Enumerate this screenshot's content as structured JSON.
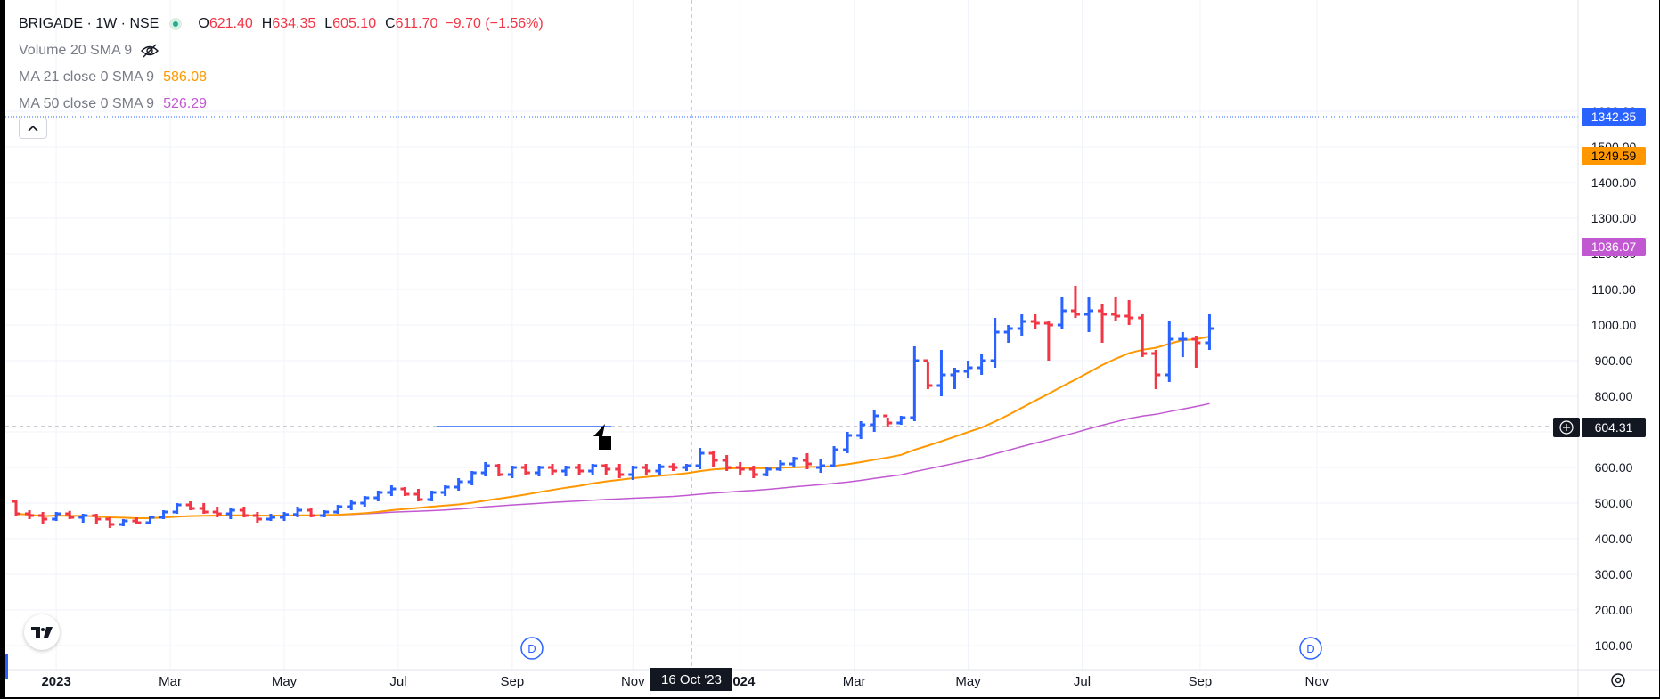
{
  "legend": {
    "symbol": "BRIGADE · 1W · NSE",
    "open_label": "O",
    "open": "621.40",
    "high_label": "H",
    "high": "634.35",
    "low_label": "L",
    "low": "605.10",
    "close_label": "C",
    "close": "611.70",
    "change": "−9.70 (−1.56%)",
    "volume": "Volume 20 SMA 9",
    "ma21_label": "MA 21 close 0 SMA 9",
    "ma21_value": "586.08",
    "ma50_label": "MA 50 close 0 SMA 9",
    "ma50_value": "526.29"
  },
  "crosshair": {
    "date_label": "16 Oct '23",
    "price_label": "604.31"
  },
  "colors": {
    "up": "#2962ff",
    "down": "#f23645",
    "ma21": "#ff9800",
    "ma50": "#c158d1",
    "grid": "#f0f3fa",
    "axis_text": "#131722"
  },
  "icons": {
    "eye_off": "eye-crossed-icon",
    "collapse": "chevron-up-icon",
    "crosshair": "plus-circle-icon",
    "logo": "tradingview-logo-icon",
    "settings": "gear-icon",
    "dividend": "dividend-marker-icon"
  },
  "chart_data": {
    "type": "ohlc-bar",
    "interval": "1W",
    "ylim": [
      50,
      1600
    ],
    "y_ticks": [
      100,
      200,
      300,
      400,
      500,
      600,
      700,
      800,
      900,
      1000,
      1100,
      1200,
      1300,
      1400,
      1500,
      1600
    ],
    "y_tick_labels": [
      "100.00",
      "200.00",
      "300.00",
      "400.00",
      "500.00",
      "600.00",
      "700.00",
      "800.00",
      "900.00",
      "1000.00",
      "1100.00",
      "1200.00",
      "1300.00",
      "1400.00",
      "1500.00",
      "1600.00"
    ],
    "x_ticks": [
      {
        "label": "2023",
        "bold": true,
        "index": 3
      },
      {
        "label": "Mar",
        "bold": false,
        "index": 11.5
      },
      {
        "label": "May",
        "bold": false,
        "index": 20
      },
      {
        "label": "Jul",
        "bold": false,
        "index": 28.5
      },
      {
        "label": "Sep",
        "bold": false,
        "index": 37
      },
      {
        "label": "Nov",
        "bold": false,
        "index": 46
      },
      {
        "label": "2024",
        "bold": true,
        "index": 54
      },
      {
        "label": "Mar",
        "bold": false,
        "index": 62.5
      },
      {
        "label": "May",
        "bold": false,
        "index": 71
      },
      {
        "label": "Jul",
        "bold": false,
        "index": 79.5
      },
      {
        "label": "Sep",
        "bold": false,
        "index": 88.3
      },
      {
        "label": "Nov",
        "bold": false,
        "index": 97
      }
    ],
    "ohlc": [
      [
        505,
        510,
        465,
        470
      ],
      [
        470,
        480,
        455,
        465
      ],
      [
        465,
        475,
        440,
        455
      ],
      [
        455,
        475,
        450,
        470
      ],
      [
        470,
        478,
        455,
        460
      ],
      [
        460,
        470,
        445,
        465
      ],
      [
        465,
        470,
        440,
        455
      ],
      [
        455,
        460,
        430,
        440
      ],
      [
        440,
        455,
        435,
        450
      ],
      [
        450,
        460,
        440,
        445
      ],
      [
        445,
        465,
        440,
        460
      ],
      [
        460,
        480,
        455,
        475
      ],
      [
        475,
        500,
        470,
        495
      ],
      [
        495,
        505,
        480,
        485
      ],
      [
        485,
        500,
        470,
        475
      ],
      [
        475,
        490,
        460,
        470
      ],
      [
        470,
        485,
        455,
        480
      ],
      [
        480,
        490,
        460,
        465
      ],
      [
        465,
        475,
        445,
        455
      ],
      [
        455,
        470,
        450,
        460
      ],
      [
        460,
        475,
        450,
        468
      ],
      [
        468,
        490,
        460,
        480
      ],
      [
        480,
        485,
        460,
        465
      ],
      [
        465,
        480,
        460,
        475
      ],
      [
        475,
        495,
        470,
        490
      ],
      [
        490,
        510,
        480,
        500
      ],
      [
        500,
        520,
        490,
        515
      ],
      [
        515,
        535,
        505,
        530
      ],
      [
        530,
        550,
        520,
        540
      ],
      [
        540,
        545,
        520,
        525
      ],
      [
        525,
        540,
        505,
        510
      ],
      [
        510,
        535,
        505,
        530
      ],
      [
        530,
        550,
        520,
        545
      ],
      [
        545,
        570,
        535,
        560
      ],
      [
        560,
        590,
        550,
        585
      ],
      [
        585,
        615,
        575,
        605
      ],
      [
        605,
        610,
        575,
        580
      ],
      [
        580,
        605,
        570,
        600
      ],
      [
        600,
        610,
        580,
        585
      ],
      [
        585,
        605,
        575,
        600
      ],
      [
        600,
        610,
        580,
        590
      ],
      [
        590,
        605,
        575,
        600
      ],
      [
        600,
        610,
        580,
        590
      ],
      [
        590,
        610,
        580,
        605
      ],
      [
        605,
        610,
        580,
        595
      ],
      [
        595,
        610,
        570,
        580
      ],
      [
        580,
        605,
        565,
        600
      ],
      [
        600,
        610,
        580,
        590
      ],
      [
        590,
        610,
        580,
        602
      ],
      [
        602,
        612,
        590,
        600
      ],
      [
        600,
        610,
        590,
        605
      ],
      [
        605,
        655,
        595,
        640
      ],
      [
        640,
        645,
        600,
        620
      ],
      [
        620,
        635,
        590,
        600
      ],
      [
        600,
        615,
        580,
        595
      ],
      [
        595,
        605,
        570,
        580
      ],
      [
        580,
        600,
        575,
        595
      ],
      [
        595,
        620,
        590,
        610
      ],
      [
        610,
        630,
        600,
        625
      ],
      [
        620,
        640,
        595,
        610
      ],
      [
        600,
        625,
        585,
        605
      ],
      [
        605,
        660,
        600,
        650
      ],
      [
        650,
        700,
        640,
        690
      ],
      [
        690,
        730,
        680,
        720
      ],
      [
        720,
        760,
        700,
        745
      ],
      [
        745,
        740,
        715,
        725
      ],
      [
        725,
        745,
        720,
        740
      ],
      [
        740,
        940,
        730,
        900
      ],
      [
        900,
        895,
        820,
        830
      ],
      [
        830,
        930,
        800,
        860
      ],
      [
        860,
        880,
        820,
        870
      ],
      [
        870,
        900,
        850,
        880
      ],
      [
        880,
        920,
        860,
        900
      ],
      [
        900,
        1020,
        880,
        980
      ],
      [
        980,
        1000,
        950,
        990
      ],
      [
        990,
        1030,
        970,
        1010
      ],
      [
        1010,
        1030,
        990,
        1005
      ],
      [
        1005,
        1010,
        900,
        1000
      ],
      [
        1000,
        1080,
        990,
        1040
      ],
      [
        1040,
        1110,
        1020,
        1030
      ],
      [
        1030,
        1080,
        980,
        1040
      ],
      [
        1040,
        1060,
        950,
        1030
      ],
      [
        1030,
        1080,
        1010,
        1025
      ],
      [
        1025,
        1070,
        1000,
        1020
      ],
      [
        1020,
        1030,
        910,
        920
      ],
      [
        920,
        930,
        820,
        860
      ],
      [
        860,
        1010,
        840,
        960
      ],
      [
        960,
        980,
        910,
        960
      ],
      [
        960,
        970,
        880,
        950
      ],
      [
        950,
        1030,
        930,
        990
      ]
    ]
  }
}
